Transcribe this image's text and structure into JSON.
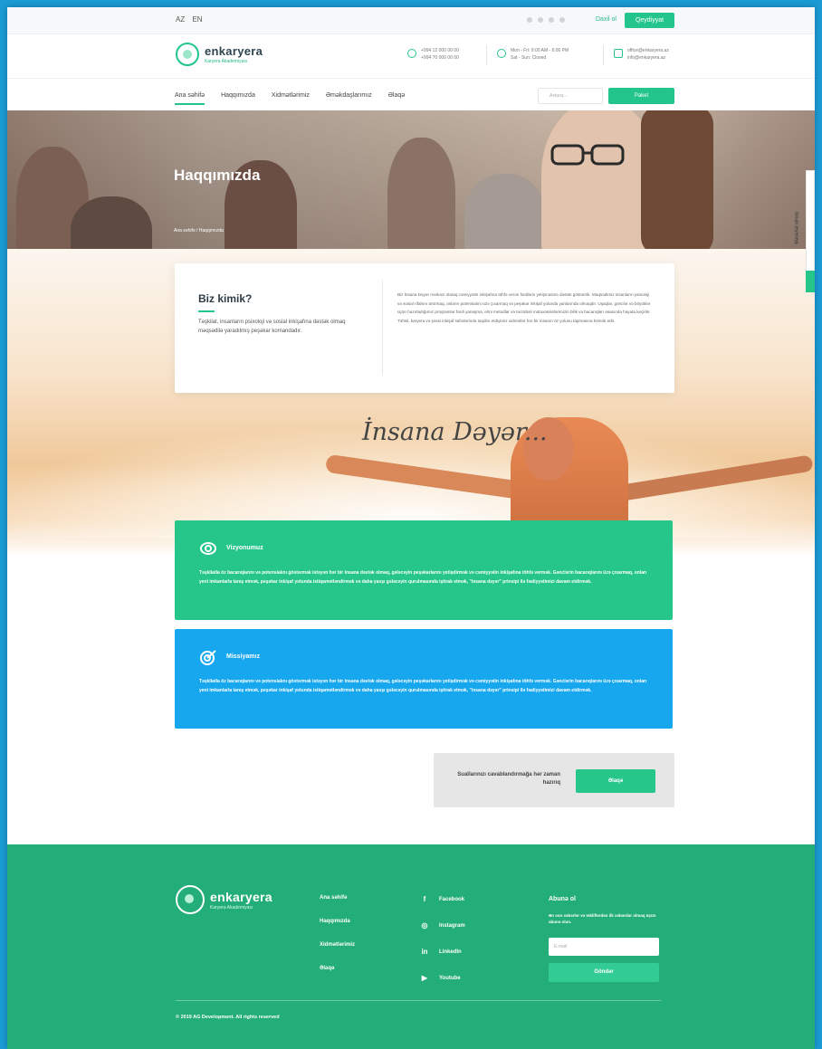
{
  "topbar": {
    "languages": [
      "AZ",
      "EN"
    ],
    "login_label": "Daxil ol",
    "register_label": "Qeydiyyat"
  },
  "header": {
    "logo_name": "enkaryera",
    "logo_sub": "Karyera Akademiyası",
    "phone_lines": [
      "+994 12 000 00 00",
      "+994 70 000 00 00"
    ],
    "hours_lines": [
      "Mon - Fri: 9:00 AM - 6:00 PM",
      "Sat - Sun: Closed"
    ],
    "email_lines": [
      "office@enkaryera.az",
      "info@enkaryera.az"
    ]
  },
  "nav": {
    "items": [
      "Ana səhifə",
      "Haqqımızda",
      "Xidmətlərimiz",
      "Əməkdaşlarımız",
      "Əlaqə"
    ],
    "search_placeholder": "Axtarış...",
    "button_label": "Paket"
  },
  "hero": {
    "title": "Haqqımızda",
    "breadcrumb": "Ana səhifə / Haqqımızda"
  },
  "about": {
    "title": "Biz kimik?",
    "subtitle": "Təşkilat, insanların psixoloji və sosial inkişafına dəstək olmaq məqsədilə yaradılmış peşəkar komandadır.",
    "text": "Biz İnsana Dəyər mərkəzi olaraq cəmiyyətin inkişafına töhfə verən fərdlərin yetişməsinə dəstək göstəririk. Məqsədimiz insanların psixoloji və sosial rifahını artırmaq, onların potensialını üzə çıxarmaq və peşəkar inkişaf yolunda yanlarında olmaqdır. Uşaqlar, gənclər və böyüklər üçün hazırladığımız proqramlar fərdi yanaşma, elmi metodlar və təcrübəli mütəxəssislərimizin bilik və bacarıqları əsasında həyata keçirilir. Təhsil, karyera və şəxsi inkişaf sahələrində təqdim etdiyimiz xidmətlər hər bir insanın öz yolunu tapmasına kömək edir.",
    "tagline": "İnsana Dəyər..."
  },
  "vision": {
    "title": "Vizyonumuz",
    "text": "Təşkilatla öz bacarıqlarını və potensialını göstərmək istəyən hər bir insana dəstək olmaq, gələcəyin peşəkarlarını yetişdirmək və cəmiyyətin inkişafına töhfə vermək. Gənclərin bacarıqlarını üzə çıxarmaq, onları yeni imkanlarla tanış etmək, peşəkar inkişaf yolunda istiqamətləndirmək və daha yaxşı gələcəyin qurulmasında iştirak etmək, \"insana dəyər\" prinsipi ilə fəaliyyətimizi davam etdirmək."
  },
  "mission": {
    "title": "Missiyamız",
    "text": "Təşkilatla öz bacarıqlarını və potensialını göstərmək istəyən hər bir insana dəstək olmaq, gələcəyin peşəkarlarını yetişdirmək və cəmiyyətin inkişafına töhfə vermək. Gənclərin bacarıqlarını üzə çıxarmaq, onları yeni imkanlarla tanış etmək, peşəkar inkişaf yolunda istiqamətləndirmək və daha yaxşı gələcəyin qurulmasında iştirak etmək, \"insana dəyər\" prinsipi ilə fəaliyyətimizi davam etdirmək."
  },
  "ask": {
    "text": "Suallarınızı cavablandırmağa hər zaman hazırıq",
    "button_label": "Əlaqə"
  },
  "side_tab": {
    "label": "Məsləhət almaq"
  },
  "footer": {
    "logo_name": "enkaryera",
    "logo_sub": "Karyera Akademiyası",
    "links": [
      "Ana səhifə",
      "Haqqımızda",
      "Xidmətlərimiz",
      "Əlaqə"
    ],
    "socials": [
      {
        "icon": "facebook-icon",
        "glyph": "f",
        "label": "Facebook"
      },
      {
        "icon": "instagram-icon",
        "glyph": "◎",
        "label": "Instagram"
      },
      {
        "icon": "linkedin-icon",
        "glyph": "in",
        "label": "LinkedIn"
      },
      {
        "icon": "youtube-icon",
        "glyph": "▶",
        "label": "Youtube"
      }
    ],
    "subscribe_title": "Abunə ol",
    "subscribe_desc": "Ən son xəbərlər və təkliflərdən ilk xəbərdar olmaq üçün abunə olun.",
    "email_placeholder": "E-mail",
    "subscribe_button": "Göndər",
    "copyright": "© 2019 AG Development. All rights reserved"
  },
  "colors": {
    "accent_green": "#26c68b",
    "accent_blue": "#17a7ee",
    "footer_green": "#23ad78"
  }
}
